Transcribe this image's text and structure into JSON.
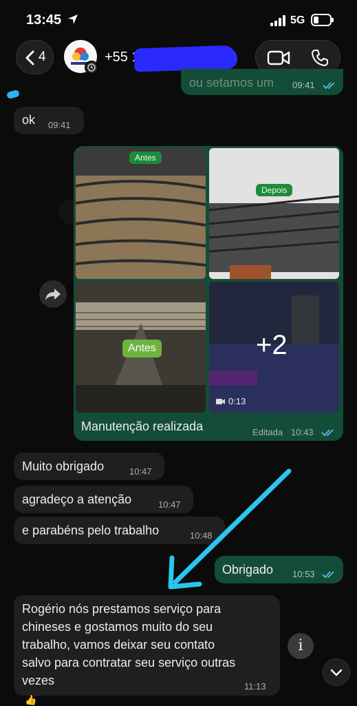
{
  "status_bar": {
    "time": "13:45",
    "network": "5G"
  },
  "header": {
    "back_count": "4",
    "contact_name": "+55 1"
  },
  "messages": {
    "previous_partial": {
      "text": "ou setamos um",
      "time": "09:41"
    },
    "ok": {
      "text": "ok",
      "time": "09:41"
    },
    "media": {
      "tag_antes_1": "Antes",
      "tag_depois": "Depois",
      "tag_antes_2": "Antes",
      "more_count": "+2",
      "video_duration": "0:13",
      "caption": "Manutenção realizada",
      "edited_label": "Editada",
      "time": "10:43"
    },
    "muito_obrigado": {
      "text": "Muito obrigado",
      "time": "10:47"
    },
    "agradeco": {
      "text": "agradeço a atenção",
      "time": "10:47"
    },
    "parabens": {
      "text": "e parabéns pelo trabalho",
      "time": "10:48"
    },
    "obrigado": {
      "text": "Obrigado",
      "time": "10:53"
    },
    "rogerio": {
      "lines": [
        "Rogério nós prestamos serviço para",
        "chineses e gostamos muito do seu",
        "trabalho, vamos deixar seu contato",
        "salvo para contratar seu serviço outras",
        "vezes"
      ],
      "time": "11:13"
    }
  },
  "colors": {
    "outgoing_bubble": "#144d37",
    "incoming_bubble": "#1f1f1f",
    "read_ticks": "#53bdeb",
    "annotation_arrow": "#29c6f0"
  }
}
